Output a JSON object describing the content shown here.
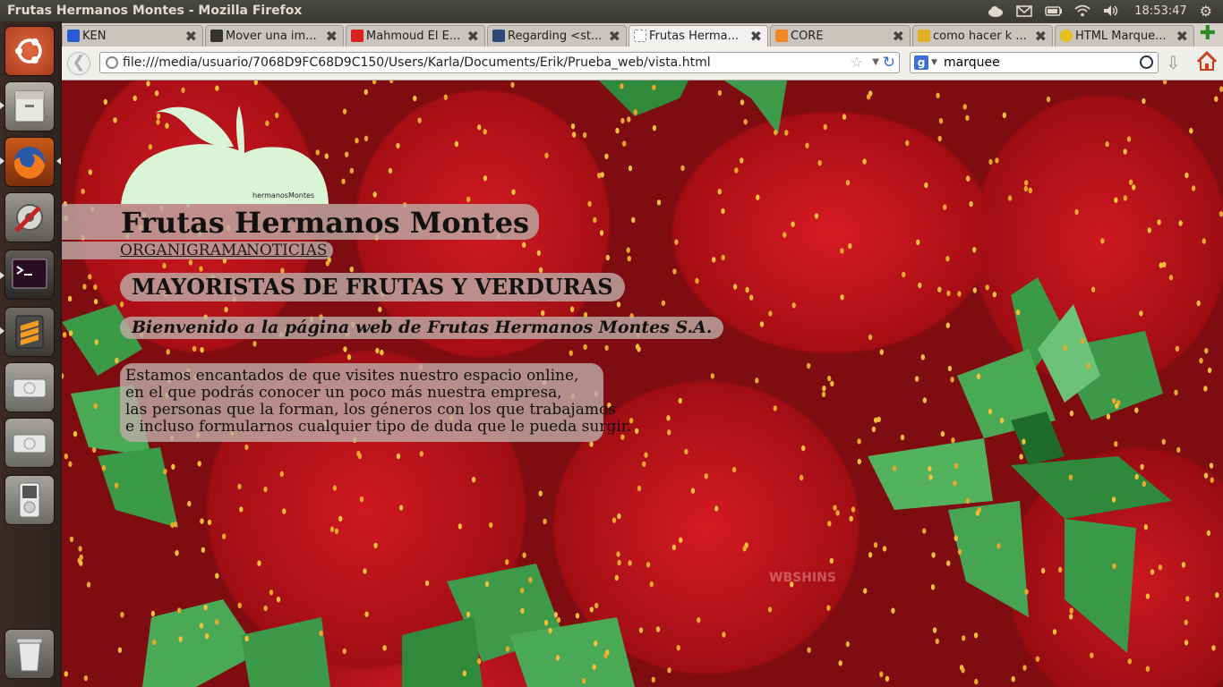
{
  "window": {
    "title": "Frutas Hermanos Montes - Mozilla Firefox"
  },
  "tray": {
    "clock": "18:53:47"
  },
  "tabs": [
    {
      "label": "KEN",
      "color": "#2a5bd7"
    },
    {
      "label": "Mover una im...",
      "color": "#333333"
    },
    {
      "label": "Mahmoud El E...",
      "color": "#d92020"
    },
    {
      "label": "Regarding <st...",
      "color": "#2c4a7a"
    },
    {
      "label": "Frutas Herma...",
      "color": "#ffffff"
    },
    {
      "label": "CORE",
      "color": "#f08a20"
    },
    {
      "label": "como hacer k ...",
      "color": "#e0b020"
    },
    {
      "label": "HTML Marque...",
      "color": "#e8c020"
    }
  ],
  "navbar": {
    "url": "file:///media/usuario/7068D9FC68D9C150/Users/Karla/Documents/Erik/Prueba_web/vista.html",
    "search_engine_glyph": "g",
    "search_value": "marquee"
  },
  "page": {
    "logo_caption": "hermanosMontes",
    "title": "Frutas Hermanos Montes",
    "nav": [
      "ORGANIGRAMA",
      "NOTICIAS"
    ],
    "heading": "MAYORISTAS DE FRUTAS Y VERDURAS",
    "welcome": "Bienvenido a la página web de Frutas Hermanos Montes S.A.",
    "paragraph": [
      "Estamos encantados de que visites nuestro espacio online,",
      "en el que podrás conocer un poco más nuestra empresa,",
      "las personas que la forman, los géneros con los que trabajamos",
      "e incluso formularnos cualquier tipo de duda que le pueda surgir."
    ],
    "watermark": "WBSHINS"
  },
  "launcher": [
    {
      "name": "ubuntu-dash-icon",
      "color": "#c2502c"
    },
    {
      "name": "files-icon",
      "color": "#8a8782"
    },
    {
      "name": "firefox-icon",
      "color": "#e8731d"
    },
    {
      "name": "system-settings-icon",
      "color": "#7b7975"
    },
    {
      "name": "terminal-icon",
      "color": "#2d2d2d"
    },
    {
      "name": "sublime-text-icon",
      "color": "#4d4d4d"
    },
    {
      "name": "drive-icon",
      "color": "#c9c9c9"
    },
    {
      "name": "drive-icon-2",
      "color": "#c9c9c9"
    },
    {
      "name": "media-player-icon",
      "color": "#bdbdbd"
    },
    {
      "name": "trash-icon",
      "color": "#a7a7a7"
    }
  ],
  "colors": {
    "logo_fill": "#d9f5d6",
    "link": "#1a1a1a",
    "bar_bg": "#beaaa5"
  }
}
